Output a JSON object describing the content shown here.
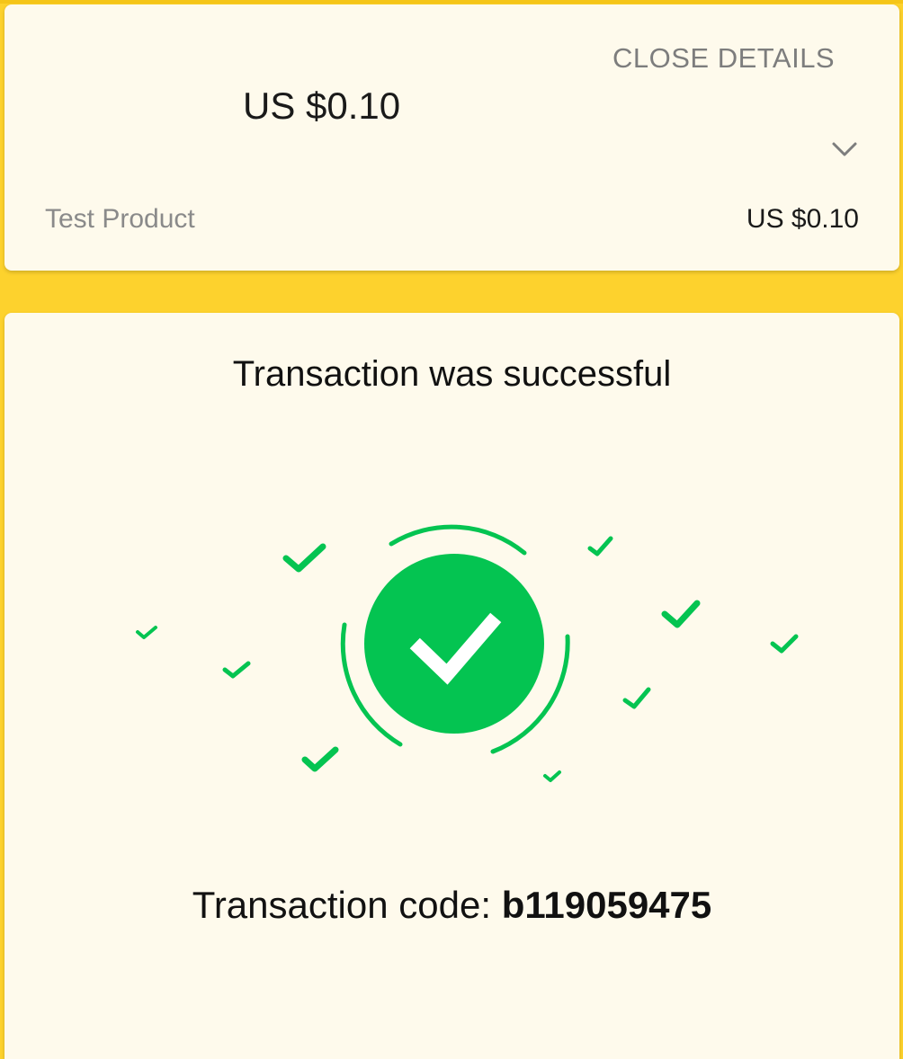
{
  "summary": {
    "close_details_label": "CLOSE DETAILS",
    "total_amount": "US $0.10",
    "line_item": {
      "name": "Test Product",
      "price": "US $0.10"
    },
    "toggle_icon": "chevron-down-icon"
  },
  "result": {
    "title": "Transaction was successful",
    "status_icon": "success-check-icon",
    "transaction_label": "Transaction code: ",
    "transaction_code": "b119059475"
  },
  "colors": {
    "page_background": "#fdd22d",
    "card_background": "#fefaec",
    "success_green": "#04c451",
    "muted_text": "#7d7d7d"
  }
}
